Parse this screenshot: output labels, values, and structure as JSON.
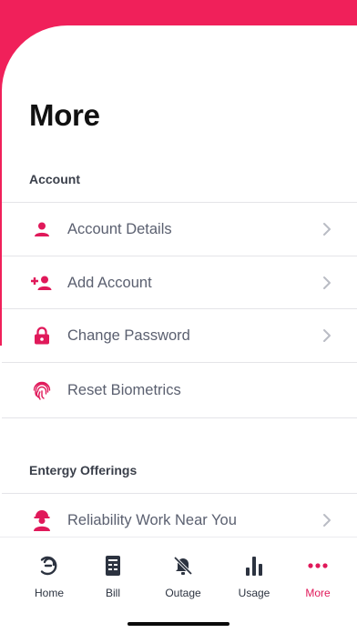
{
  "page": {
    "title": "More"
  },
  "sections": [
    {
      "label": "Account",
      "items": [
        {
          "label": "Account Details",
          "icon": "user-icon",
          "chevron": true
        },
        {
          "label": "Add Account",
          "icon": "add-user-icon",
          "chevron": true
        },
        {
          "label": "Change Password",
          "icon": "lock-icon",
          "chevron": true
        },
        {
          "label": "Reset Biometrics",
          "icon": "fingerprint-icon",
          "chevron": false
        }
      ]
    },
    {
      "label": "Entergy Offerings",
      "items": [
        {
          "label": "Reliability Work Near You",
          "icon": "worker-icon",
          "chevron": true
        }
      ]
    }
  ],
  "tabbar": {
    "tabs": [
      {
        "label": "Home",
        "icon": "home-icon",
        "active": false
      },
      {
        "label": "Bill",
        "icon": "bill-icon",
        "active": false
      },
      {
        "label": "Outage",
        "icon": "outage-icon",
        "active": false
      },
      {
        "label": "Usage",
        "icon": "usage-icon",
        "active": false
      },
      {
        "label": "More",
        "icon": "more-icon",
        "active": true
      }
    ]
  },
  "colors": {
    "accent": "#e0195a",
    "header_pink": "#f0205a",
    "text_gray": "#5b6070",
    "tab_gray": "#2c3340"
  }
}
